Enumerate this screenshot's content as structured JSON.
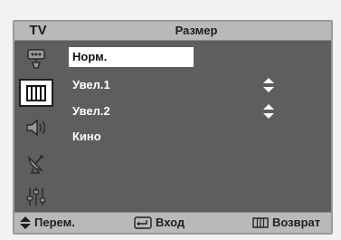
{
  "header": {
    "source_label": "TV",
    "title": "Размер"
  },
  "sidebar": {
    "items": [
      {
        "icon": "antenna-input-icon",
        "active": false
      },
      {
        "icon": "picture-icon",
        "active": true
      },
      {
        "icon": "speaker-icon",
        "active": false
      },
      {
        "icon": "satellite-dish-icon",
        "active": false
      },
      {
        "icon": "setup-sliders-icon",
        "active": false
      }
    ]
  },
  "options": [
    {
      "label": "Норм.",
      "selected": true,
      "has_arrows": false
    },
    {
      "label": "Увел.1",
      "selected": false,
      "has_arrows": true
    },
    {
      "label": "Увел.2",
      "selected": false,
      "has_arrows": true
    },
    {
      "label": "Кино",
      "selected": false,
      "has_arrows": false
    }
  ],
  "footer": {
    "move_label": "Перем.",
    "enter_label": "Вход",
    "return_label": "Возврат"
  },
  "colors": {
    "panel": "#5e5e5e",
    "header": "#b9b9b9",
    "highlight": "#ffffff"
  }
}
